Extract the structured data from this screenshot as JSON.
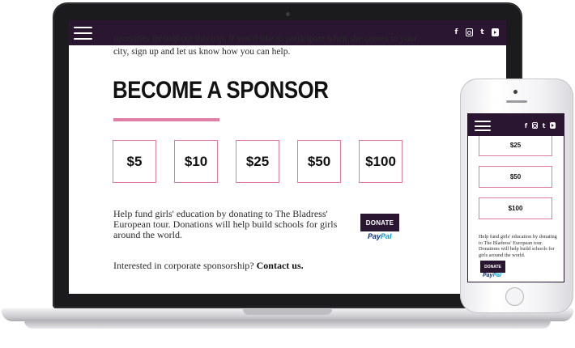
{
  "nav": {
    "social_icons": [
      "facebook-icon",
      "instagram-icon",
      "twitter-icon",
      "youtube-icon"
    ],
    "facebook_glyph": "f",
    "twitter_glyph": "t",
    "background": "#2a1630"
  },
  "laptop": {
    "intro_text": "necesities throughout this trip. If you'd like to participate when she comes to your city, sign up and let us know how you can help.",
    "title": "BECOME A SPONSOR",
    "amounts": [
      "$5",
      "$10",
      "$25",
      "$50",
      "$100"
    ],
    "help_text": "Help fund girls' education by donating to The Bladress' European tour. Donations will help build schools for girls around the world.",
    "donate_label": "DONATE",
    "paypal_pay": "Pay",
    "paypal_pal": "Pal",
    "corporate_text": "Interested in corporate sponsorship?",
    "contact_link": "Contact us."
  },
  "phone": {
    "amounts": [
      "$25",
      "$50",
      "$100"
    ],
    "help_text": "Help fund girls' education by donating to The Bladress' European tour. Donations will help build schools for girls around the world.",
    "donate_label": "DONATE",
    "paypal_pay": "Pay",
    "paypal_pal": "Pal"
  },
  "colors": {
    "accent_pink": "#e17ea3",
    "brand_purple": "#2a1630",
    "paypal_dark": "#003087",
    "paypal_light": "#009cde"
  }
}
